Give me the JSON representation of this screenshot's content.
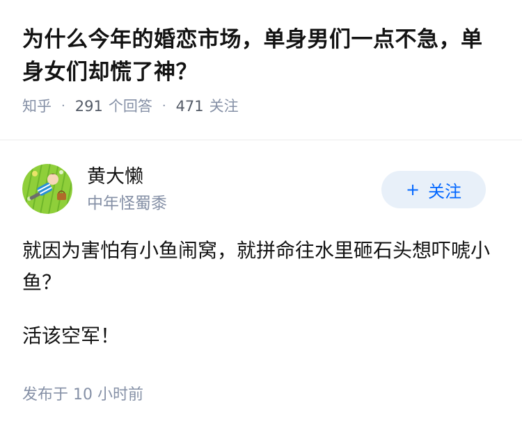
{
  "question": {
    "title": "为什么今年的婚恋市场，单身男们一点不急，单身女们却慌了神？",
    "source": "知乎",
    "answer_count": "291",
    "answer_label": "个回答",
    "follower_count": "471",
    "follower_label": "关注"
  },
  "author": {
    "name": "黄大懒",
    "tagline": "中年怪蜀黍",
    "avatar_icon": "avatar-illustration",
    "follow_button_label": "关注",
    "follow_icon": "plus-icon"
  },
  "answer": {
    "paragraphs": [
      "就因为害怕有小鱼闹窝，就拼命往水里砸石头想吓唬小鱼？",
      "活该空军！"
    ]
  },
  "footer": {
    "published_prefix": "发布于",
    "published_time": "10 小时前"
  },
  "colors": {
    "primary_text": "#121212",
    "secondary_text": "#8590a6",
    "accent": "#0066ff",
    "follow_bg": "#e8f0f9"
  }
}
